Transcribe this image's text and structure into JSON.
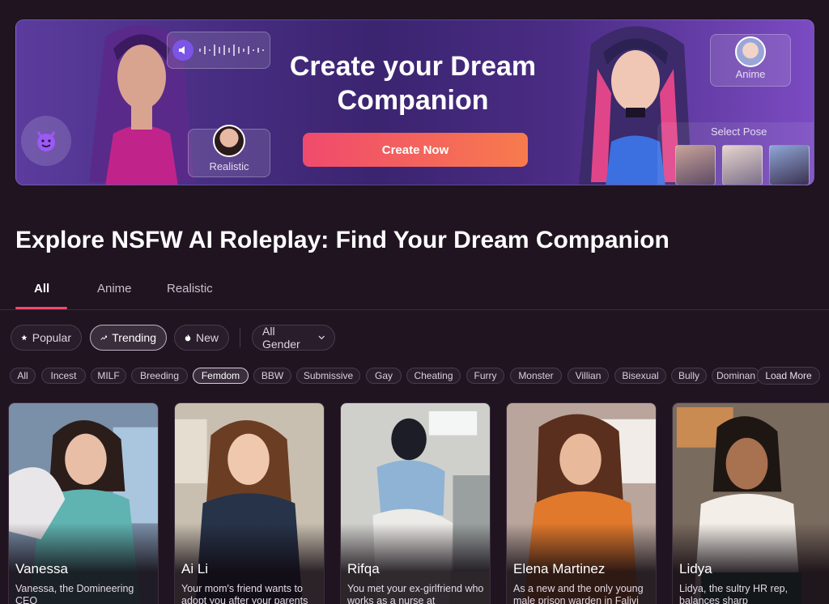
{
  "banner": {
    "title": "Create your Dream Companion",
    "button": "Create Now",
    "realistic_label": "Realistic",
    "anime_label": "Anime",
    "select_pose_label": "Select Pose",
    "icons": [
      "devil-face-icon",
      "speaker-icon",
      "waveform-icon"
    ]
  },
  "page_title": "Explore NSFW AI Roleplay: Find Your Dream Companion",
  "tabs": [
    "All",
    "Anime",
    "Realistic"
  ],
  "sort": {
    "popular": "Popular",
    "trending": "Trending",
    "new": "New",
    "gender": "All Gender"
  },
  "tags": [
    "All",
    "Incest",
    "MILF",
    "Breeding",
    "Femdom",
    "BBW",
    "Submissive",
    "Gay",
    "Cheating",
    "Furry",
    "Monster",
    "Villian",
    "Bisexual",
    "Bully",
    "Dominan"
  ],
  "load_more": "Load More",
  "cards": [
    {
      "name": "Vanessa",
      "desc": "Vanessa, the Domineering CEO"
    },
    {
      "name": "Ai Li",
      "desc": "Your mom's friend wants to adopt you after your parents"
    },
    {
      "name": "Rifqa",
      "desc": "You met your ex-girlfriend who works as a nurse at"
    },
    {
      "name": "Elena Martinez",
      "desc": "As a new and the only young male prison warden in Falivi"
    },
    {
      "name": "Lidya",
      "desc": "Lidya, the sultry HR rep, balances sharp"
    }
  ],
  "colors": {
    "accent": "#f04a6d",
    "background": "#1f1420"
  }
}
